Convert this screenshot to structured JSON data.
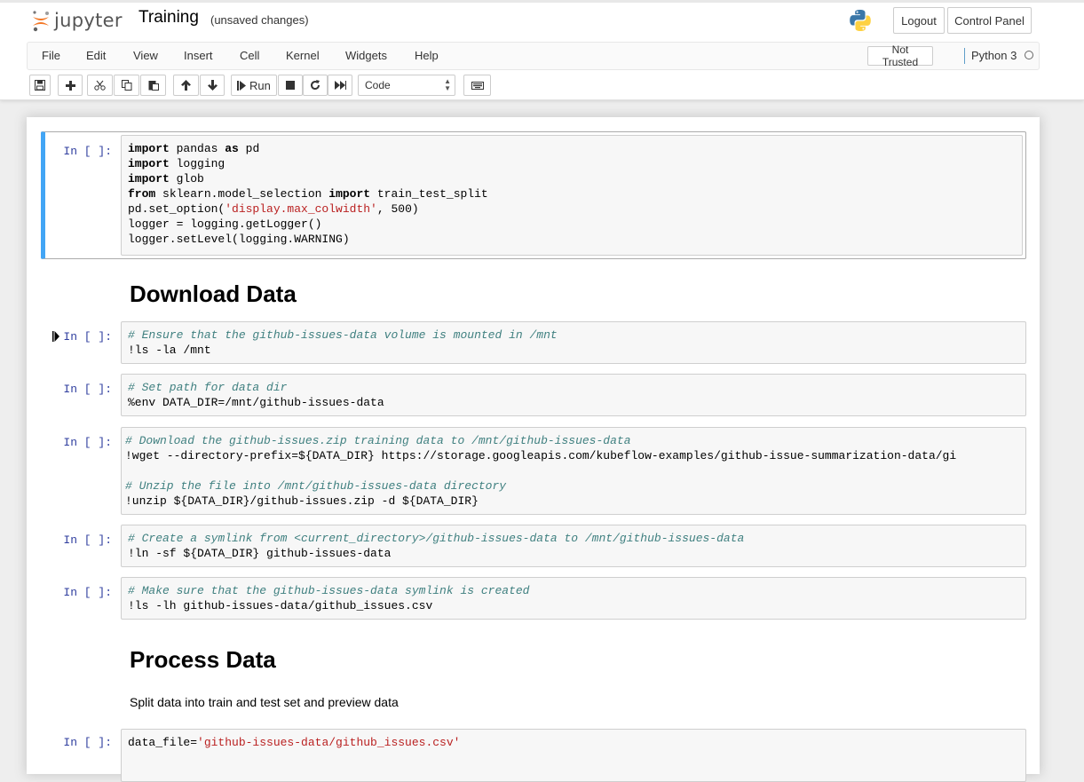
{
  "header": {
    "logo_text": "jupyter",
    "notebook_name": "Training",
    "save_status": "(unsaved changes)",
    "logout_label": "Logout",
    "control_panel_label": "Control Panel"
  },
  "menu": {
    "items": [
      "File",
      "Edit",
      "View",
      "Insert",
      "Cell",
      "Kernel",
      "Widgets",
      "Help"
    ],
    "trust": "Not Trusted",
    "kernel": "Python 3"
  },
  "toolbar": {
    "run_label": "Run",
    "cell_type": "Code",
    "icons": [
      "save-icon",
      "plus-icon",
      "cut-icon",
      "copy-icon",
      "paste-icon",
      "arrow-up-icon",
      "arrow-down-icon",
      "step-forward-icon",
      "stop-icon",
      "restart-icon",
      "fast-forward-icon",
      "keyboard-icon"
    ]
  },
  "colors": {
    "accent_blue": "#42a5f5",
    "prompt_blue": "#303f9f",
    "string_red": "#ba2121",
    "comment_teal": "#408080"
  },
  "cells": [
    {
      "prompt": "In [ ]:",
      "lines": [
        "import pandas as pd",
        "import logging",
        "import glob",
        "from sklearn.model_selection import train_test_split",
        "pd.set_option('display.max_colwidth', 500)",
        "logger = logging.getLogger()",
        "logger.setLevel(logging.WARNING)"
      ]
    },
    {
      "heading": "Download Data"
    },
    {
      "prompt": "In [ ]:",
      "lines": [
        "# Ensure that the github-issues-data volume is mounted in /mnt",
        "!ls -la /mnt"
      ]
    },
    {
      "prompt": "In [ ]:",
      "lines": [
        "# Set path for data dir",
        "%env DATA_DIR=/mnt/github-issues-data"
      ]
    },
    {
      "prompt": "In [ ]:",
      "lines": [
        "# Download the github-issues.zip training data to /mnt/github-issues-data",
        "!wget --directory-prefix=${DATA_DIR} https://storage.googleapis.com/kubeflow-examples/github-issue-summarization-data/gi",
        "",
        "# Unzip the file into /mnt/github-issues-data directory",
        "!unzip ${DATA_DIR}/github-issues.zip -d ${DATA_DIR}"
      ]
    },
    {
      "prompt": "In [ ]:",
      "lines": [
        "# Create a symlink from <current_directory>/github-issues-data to /mnt/github-issues-data",
        "!ln -sf ${DATA_DIR} github-issues-data"
      ]
    },
    {
      "prompt": "In [ ]:",
      "lines": [
        "# Make sure that the github-issues-data symlink is created",
        "!ls -lh github-issues-data/github_issues.csv"
      ]
    },
    {
      "heading": "Process Data"
    },
    {
      "text": "Split data into train and test set and preview data"
    },
    {
      "prompt": "In [ ]:",
      "lines": [
        "data_file='github-issues-data/github_issues.csv'"
      ]
    }
  ]
}
